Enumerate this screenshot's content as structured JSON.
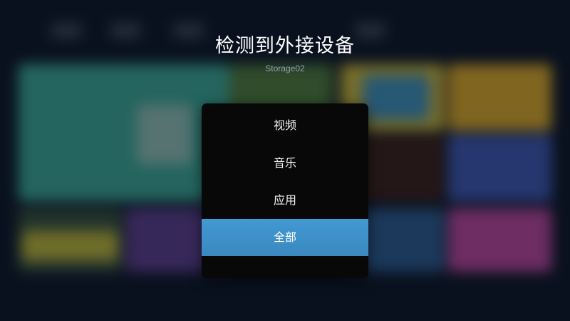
{
  "dialog": {
    "title": "检测到外接设备",
    "device_name": "Storage02",
    "options": [
      {
        "label": "视频",
        "selected": false
      },
      {
        "label": "音乐",
        "selected": false
      },
      {
        "label": "应用",
        "selected": false
      },
      {
        "label": "全部",
        "selected": true
      }
    ]
  },
  "colors": {
    "selection": "#3d8ec9",
    "dialog_background": "#080808",
    "title_text": "#ffffff",
    "subtitle_text": "#9aa3ad"
  }
}
